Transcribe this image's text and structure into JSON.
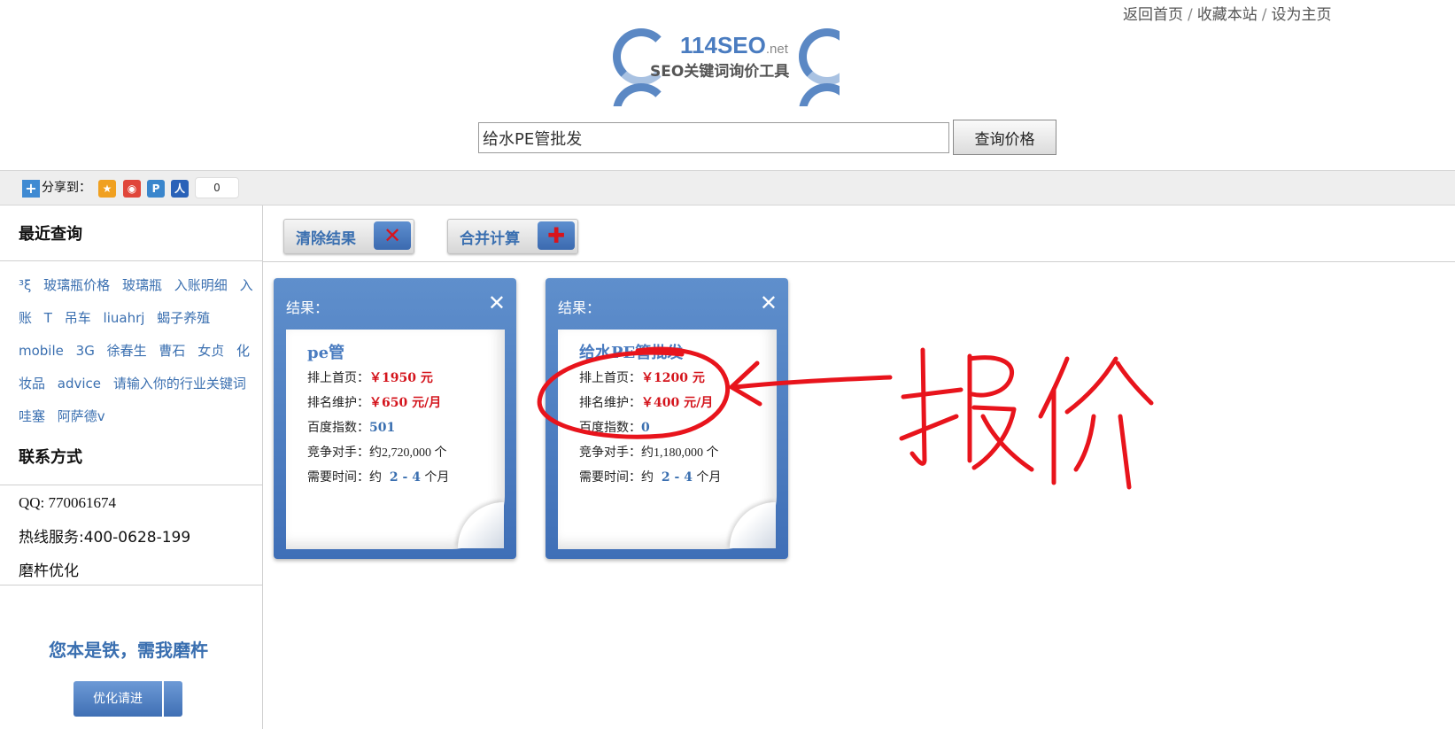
{
  "top_links": [
    "返回首页",
    "收藏本站",
    "设为主页"
  ],
  "logo": {
    "brand": "114SEO",
    "brand_suffix": ".net",
    "subtitle": "SEO关键词询价工具"
  },
  "search": {
    "value": "给水PE管批发",
    "button_label": "查询价格"
  },
  "share": {
    "label": "分享到：",
    "count": "0"
  },
  "sidebar": {
    "recent_title": "最近查询",
    "recent_items": [
      "³ξ",
      "玻璃瓶价格",
      "玻璃瓶",
      "入账明细",
      "入账",
      "T",
      "吊车",
      "liuahrj",
      "蝎子养殖",
      "mobile",
      "3G",
      "徐春生",
      "曹石",
      "女贞",
      "化妆品",
      "advice",
      "请输入你的行业关键词",
      "哇塞",
      "阿萨德v"
    ],
    "contact_title": "联系方式",
    "qq": "QQ: 770061674",
    "hotline": "热线服务:400-0628-199",
    "company": "磨杵优化",
    "slogan": "您本是铁，需我磨杵",
    "opt_button": "优化请进"
  },
  "actions": {
    "clear": "清除结果",
    "merge": "合并计算"
  },
  "results": [
    {
      "header": "结果：",
      "keyword": "pe管",
      "rank_label": "排上首页：",
      "rank_price": "￥1950 元",
      "maint_label": "排名维护：",
      "maint_price": "￥650 元/月",
      "index_label": "百度指数：",
      "index_value": "501",
      "competitors_label": "竞争对手：",
      "competitors_value": "约2,720,000 个",
      "time_label": "需要时间：约",
      "time_value": "2 - 4",
      "time_unit": "个月"
    },
    {
      "header": "结果：",
      "keyword": "给水PE管批发",
      "rank_label": "排上首页：",
      "rank_price": "￥1200 元",
      "maint_label": "排名维护：",
      "maint_price": "￥400 元/月",
      "index_label": "百度指数：",
      "index_value": "0",
      "competitors_label": "竞争对手：",
      "competitors_value": "约1,180,000 个",
      "time_label": "需要时间：约",
      "time_value": "2 - 4",
      "time_unit": "个月"
    }
  ],
  "annotation": {
    "text": "报价",
    "color": "#e8141c"
  }
}
